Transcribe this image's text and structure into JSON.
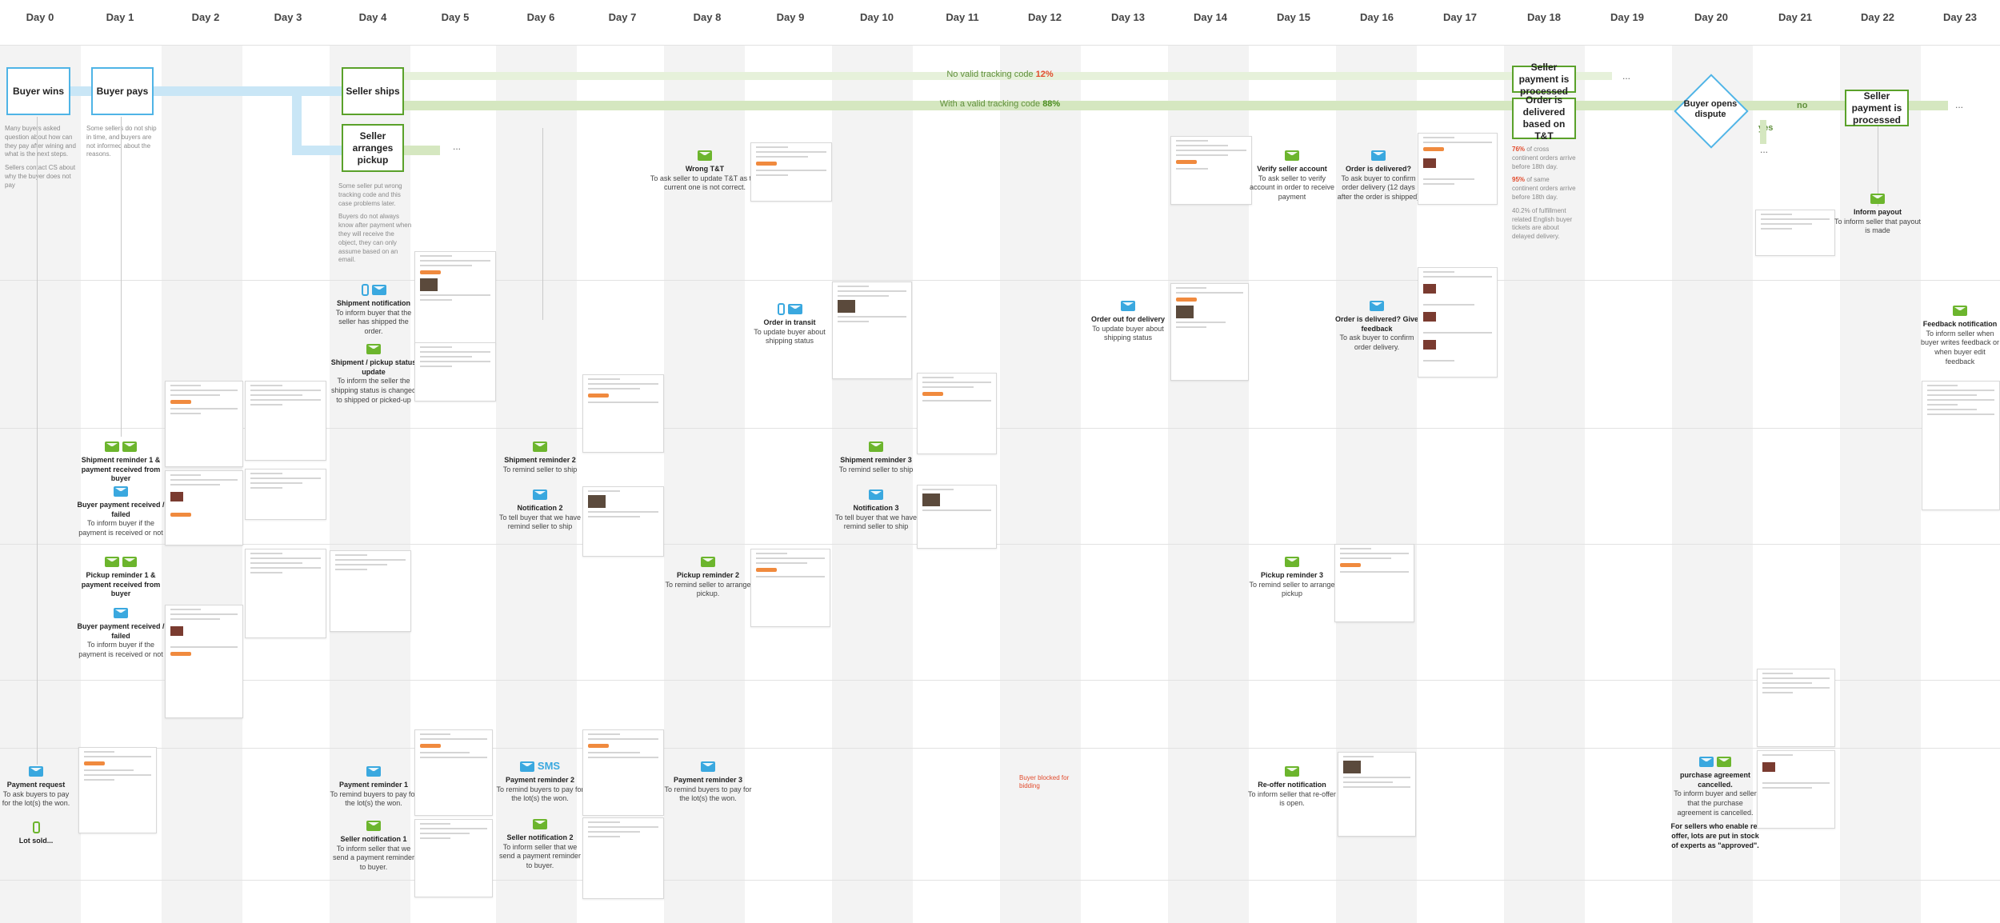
{
  "days": [
    "Day 0",
    "Day 1",
    "Day 2",
    "Day 3",
    "Day 4",
    "Day 5",
    "Day 6",
    "Day 7",
    "Day 8",
    "Day 9",
    "Day 10",
    "Day 11",
    "Day 12",
    "Day 13",
    "Day 14",
    "Day 15",
    "Day 16",
    "Day 17",
    "Day 18",
    "Day 19",
    "Day 20",
    "Day 21",
    "Day 22",
    "Day 23"
  ],
  "main_flow": {
    "buyer_wins": "Buyer wins",
    "buyer_pays": "Buyer pays",
    "seller_ships": "Seller ships",
    "seller_arranges_pickup": "Seller arranges pickup",
    "seller_payment_processed_top": "Seller payment is processed",
    "order_delivered": "Order is delivered based on T&T",
    "buyer_opens_dispute": "Buyer opens dispute",
    "seller_payment_processed_right": "Seller payment is processed",
    "no_label": "no",
    "yes_label": "yes",
    "ellipsis": "..."
  },
  "tracks": {
    "no_valid_prefix": "No valid tracking code",
    "no_valid_pct": "12%",
    "with_valid_prefix": "With a valid tracking code",
    "with_valid_pct": "88%"
  },
  "notes": {
    "day0": [
      "Many buyers asked question about how can they pay after wining and what is the next steps.",
      "Sellers contact CS about why the buyer does not pay"
    ],
    "day1": [
      "Some sellers do not ship in time, and buyers are not informed about the reasons."
    ],
    "day4": [
      "Some seller put wrong tracking code and this case problems later.",
      "Buyers do not always know after payment when they will receive the object, they can only assume based on an email."
    ],
    "day18": [
      {
        "hl": "76%",
        "text": " of cross continent orders arrive before 18th day."
      },
      {
        "hl": "95%",
        "text": " of same continent orders arrive before 18th day."
      },
      {
        "hl": "",
        "text": "40.2% of fulfillment related English buyer tickets are about delayed delivery."
      }
    ]
  },
  "events": {
    "wrong_tt": {
      "title": "Wrong T&T",
      "desc": "To ask seller to update T&T as the current one is not correct."
    },
    "verify_account": {
      "title": "Verify seller account",
      "desc": "To ask seller to verify account in order to receive payment"
    },
    "order_delivered_q1": {
      "title": "Order is delivered?",
      "desc": "To ask buyer to confirm order delivery (12 days after the order is shipped)"
    },
    "inform_payout": {
      "title": "Inform payout",
      "desc": "To inform seller that payout is made"
    },
    "shipment_notification": {
      "title": "Shipment notification",
      "desc": "To inform buyer that the seller has shipped the order."
    },
    "shipment_pickup_status": {
      "title": "Shipment / pickup status update",
      "desc": "To inform the seller the shipping status is changed to shipped or picked-up"
    },
    "order_in_transit": {
      "title": "Order in transit",
      "desc": "To update buyer about shipping status"
    },
    "order_out_for_delivery": {
      "title": "Order out for delivery",
      "desc": "To update buyer about shipping status"
    },
    "order_delivered_q2": {
      "title": "Order is delivered? Give feedback",
      "desc": "To ask buyer to confirm order delivery."
    },
    "feedback_notification": {
      "title": "Feedback notification",
      "desc": "To inform seller when buyer writes feedback or when buyer edit feedback"
    },
    "shipment_reminder1": {
      "title": "Shipment reminder 1 & payment received from buyer",
      "desc": ""
    },
    "buyer_payment_received": {
      "title": "Buyer payment received / failed",
      "desc": "To inform buyer if the payment is received or not"
    },
    "shipment_reminder2": {
      "title": "Shipment reminder 2",
      "desc": "To remind seller to ship"
    },
    "notification2": {
      "title": "Notification 2",
      "desc": "To tell buyer that we have remind seller to ship"
    },
    "shipment_reminder3": {
      "title": "Shipment reminder 3",
      "desc": "To remind seller to ship"
    },
    "notification3": {
      "title": "Notification 3",
      "desc": "To tell buyer that we have remind seller to ship"
    },
    "pickup_reminder1": {
      "title": "Pickup reminder 1 & payment received from buyer",
      "desc": ""
    },
    "buyer_payment_received2": {
      "title": "Buyer payment received / failed",
      "desc": "To inform buyer if the payment is received or not"
    },
    "pickup_reminder2": {
      "title": "Pickup reminder 2",
      "desc": "To remind seller to arrange pickup."
    },
    "pickup_reminder3": {
      "title": "Pickup reminder 3",
      "desc": "To remind seller to arrange pickup"
    },
    "payment_request": {
      "title": "Payment request",
      "desc": "To ask buyers to pay for the lot(s) the won."
    },
    "lot_sold": {
      "title": "Lot sold...",
      "desc": ""
    },
    "payment_reminder1": {
      "title": "Payment reminder 1",
      "desc": "To remind buyers to pay for the lot(s) the won."
    },
    "seller_notification1": {
      "title": "Seller notification 1",
      "desc": "To inform seller that we send a payment reminder to buyer."
    },
    "payment_reminder2": {
      "title": "Payment reminder 2",
      "desc": "To remind buyers to pay for the lot(s) the won."
    },
    "seller_notification2": {
      "title": "Seller notification 2",
      "desc": "To inform seller that we send a payment reminder to buyer."
    },
    "payment_reminder3": {
      "title": "Payment reminder 3",
      "desc": "To remind buyers to pay for the lot(s) the won."
    },
    "reoffer_notification": {
      "title": "Re-offer notification",
      "desc": "To inform seller that re-offer is open."
    },
    "purchase_cancelled": {
      "title": "purchase agreement cancelled.",
      "desc": "To inform buyer and seller that the purchase agreement is cancelled."
    },
    "purchase_cancelled_extra": "For sellers who enable re-offer, lots are put in stock of experts as \"approved\"."
  },
  "sms_label": "SMS",
  "buyer_blocked": "Buyer blocked for bidding",
  "colors": {
    "green": "#5aa12a",
    "blue": "#4fb4e6",
    "track": "#d5e7c0",
    "highlight": "#e24b2c",
    "button": "#f08a3e"
  }
}
